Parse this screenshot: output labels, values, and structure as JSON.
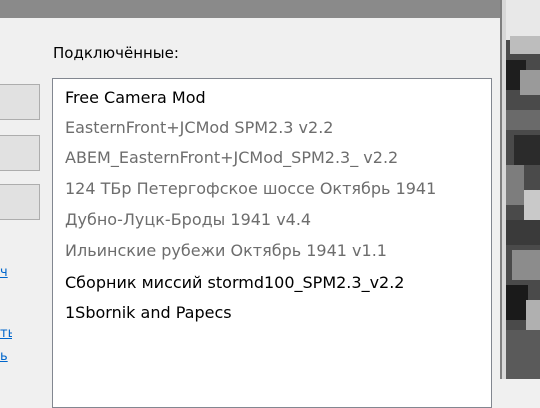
{
  "dialog": {
    "connected_label": "Подключённые:",
    "connected_mods": [
      {
        "name": "Free Camera Mod",
        "enabled": true
      },
      {
        "name": "EasternFront+JCMod SPM2.3 v2.2",
        "enabled": false
      },
      {
        "name": "ABEM_EasternFront+JCMod_SPM2.3_ v2.2",
        "enabled": false
      },
      {
        "name": "124 ТБр Петергофское шоссе Октябрь 1941",
        "enabled": false
      },
      {
        "name": "Дубно-Луцк-Броды 1941 v4.4",
        "enabled": false
      },
      {
        "name": "Ильинские рубежи Октябрь 1941 v1.1",
        "enabled": false
      },
      {
        "name": "Сборник миссий stormd100_SPM2.3_v2.2",
        "enabled": true
      },
      {
        "name": "1Sbornik and Papecs",
        "enabled": true
      }
    ],
    "left_links": [
      "ч",
      "ть",
      "ь"
    ]
  },
  "colors": {
    "enabled_text": "#000000",
    "disabled_text": "#6d6d6d",
    "link": "#0066cc",
    "titlebar": "#8a8a8a"
  }
}
